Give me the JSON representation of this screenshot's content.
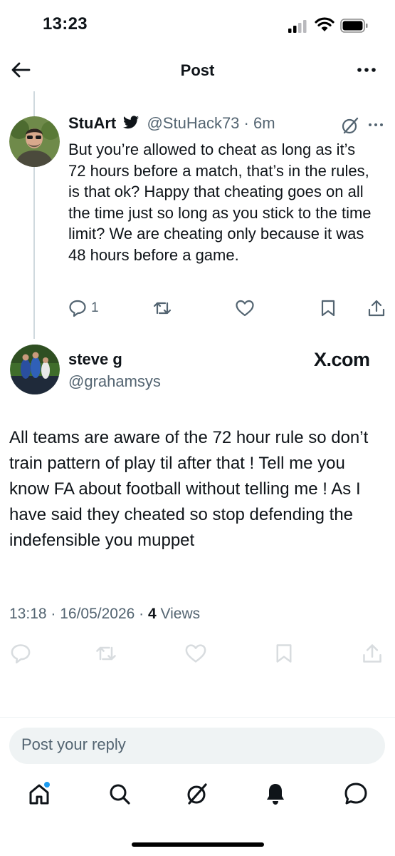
{
  "status_bar": {
    "time": "13:23"
  },
  "header": {
    "title": "Post"
  },
  "parent_tweet": {
    "name": "StuArt",
    "handle_time": "@StuHack73 · 6m",
    "text": "But you’re allowed to cheat as long as it’s 72 hours before a match, that’s in the rules, is that ok? Happy that cheating goes on all the time just so long as you stick to the time limit? We are cheating only because it was 48 hours before a game.",
    "reply_count": "1"
  },
  "main_tweet": {
    "name": "steve g",
    "handle": "@grahamsys",
    "source": "X.com",
    "text": "All teams are aware of the 72 hour rule so don’t train pattern of play til after that ! Tell me you know FA about football without telling me ! As I have said they cheated so stop defending the indefensible you muppet",
    "timestamp": "13:18 · 16/05/2026 · ",
    "views_count": "4",
    "views_label": " Views"
  },
  "reply": {
    "placeholder": "Post your reply"
  },
  "colors": {
    "accent": "#1d9bf0",
    "text": "#0f1419",
    "muted": "#536471"
  }
}
